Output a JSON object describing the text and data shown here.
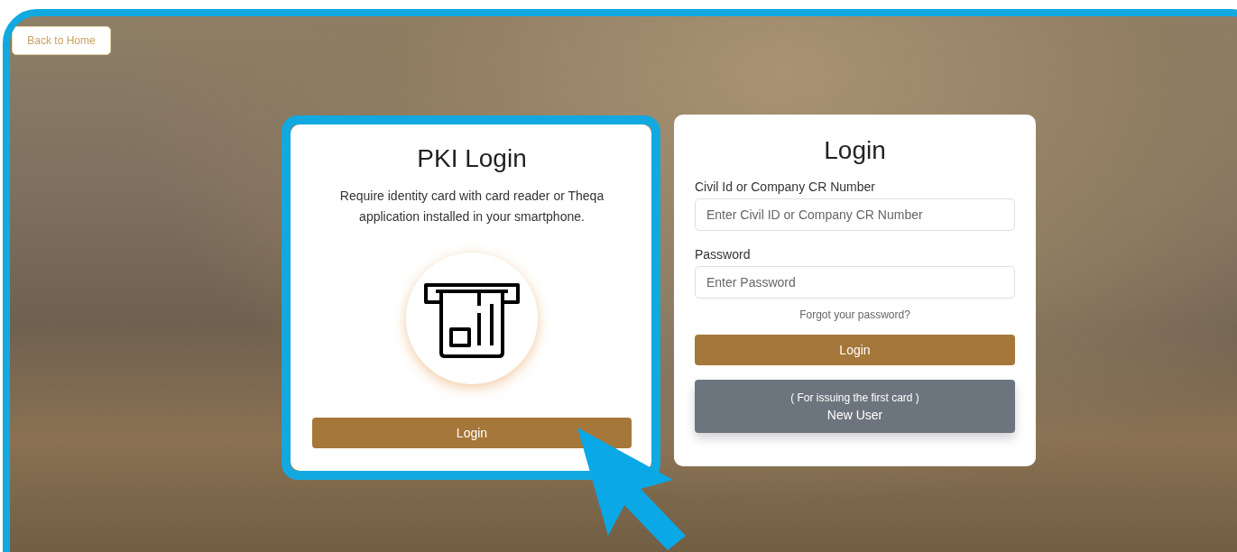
{
  "back_button": {
    "label": "Back to Home"
  },
  "pki_card": {
    "title": "PKI Login",
    "highlighted": true,
    "description": "Require identity card with card reader or Theqa application installed in your smartphone.",
    "button": "Login"
  },
  "login_card": {
    "title": "Login",
    "fields": [
      {
        "label": "Civil Id or Company CR Number",
        "placeholder": "Enter Civil ID or Company CR Number"
      },
      {
        "label": "Password",
        "placeholder": "Enter Password"
      }
    ],
    "forgot_link": "Forgot your password?",
    "login_button": "Login",
    "new_user_button": {
      "note": "( For issuing the first card )",
      "label": "New User"
    }
  }
}
